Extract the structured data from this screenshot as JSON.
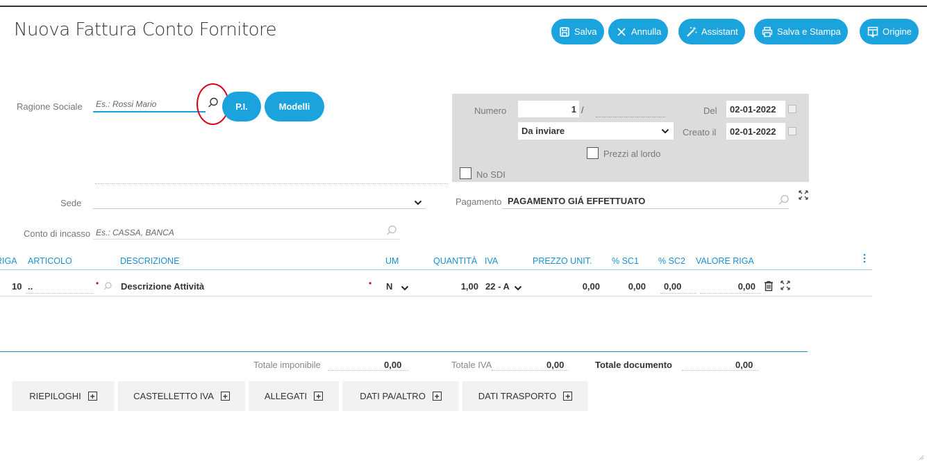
{
  "page": {
    "title": "Nuova Fattura Conto Fornitore"
  },
  "toolbar": {
    "save": "Salva",
    "cancel": "Annulla",
    "assistant": "Assistant",
    "save_print": "Salva e Stampa",
    "origin": "Origine"
  },
  "supplier": {
    "label": "Ragione Sociale",
    "placeholder": "Es.: Rossi Mario",
    "pi_button": "P.I.",
    "models_button": "Modelli"
  },
  "doc": {
    "number_label": "Numero",
    "number_value": "1",
    "number_sep": "/",
    "date_label": "Del",
    "date_value": "02-01-2022",
    "status_value": "Da inviare",
    "created_label": "Creato il",
    "created_value": "02-01-2022",
    "gross_prices_label": "Prezzi al lordo",
    "no_sdi_label": "No SDI"
  },
  "sede": {
    "label": "Sede"
  },
  "payment": {
    "label": "Pagamento",
    "value": "PAGAMENTO GIÁ EFFETTUATO"
  },
  "account": {
    "label": "Conto di incasso",
    "placeholder": "Es.: CASSA, BANCA"
  },
  "table": {
    "headers": {
      "riga": "RIGA",
      "articolo": "ARTICOLO",
      "descrizione": "DESCRIZIONE",
      "um": "UM",
      "quantita": "QUANTITÀ",
      "iva": "IVA",
      "prezzo": "PREZZO UNIT.",
      "sc1": "% SC1",
      "sc2": "% SC2",
      "valore": "VALORE RIGA"
    },
    "rows": [
      {
        "riga": "10",
        "articolo": "..",
        "descrizione": "Descrizione Attività",
        "um": "N",
        "quantita": "1,00",
        "iva": "22 - A",
        "prezzo": "0,00",
        "sc1": "0,00",
        "sc2": "0,00",
        "valore": "0,00"
      }
    ]
  },
  "totals": {
    "imponibile_label": "Totale imponibile",
    "imponibile_value": "0,00",
    "iva_label": "Totale IVA",
    "iva_value": "0,00",
    "documento_label": "Totale documento",
    "documento_value": "0,00"
  },
  "tabs": {
    "riepiloghi": "RIEPILOGHI",
    "castelletto": "CASTELLETTO IVA",
    "allegati": "ALLEGATI",
    "dati_pa": "DATI PA/ALTRO",
    "dati_trasporto": "DATI TRASPORTO"
  },
  "colors": {
    "accent": "#1ba3de",
    "header_blue": "#1a8fd0",
    "highlight_circle": "#d9001b",
    "panel_gray": "#dcdcdc"
  }
}
